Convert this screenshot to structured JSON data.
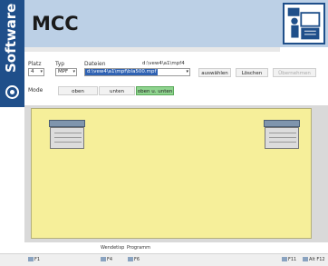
{
  "sidebar": {
    "label": "Software"
  },
  "header": {
    "title": "MCC"
  },
  "form": {
    "platz_label": "Platz",
    "platz_value": "4",
    "typ_label": "Typ",
    "typ_value": "MPF",
    "dateien_label": "Dateien",
    "path": "d:\\vew4\\a1\\mpf4",
    "file_value": "d:\\vew4\\a1\\mpf\\bla500.mpf",
    "btn_select": "auswählen",
    "btn_delete": "Löschen",
    "btn_disabled": "Übernehmen",
    "mode_label": "Mode",
    "mode_oben": "oben",
    "mode_unten": "unten",
    "mode_both": "oben u. unten"
  },
  "bottom": {
    "label_wendetisch": "Wendetisp",
    "label_programm": "Programm"
  },
  "footer": {
    "keys": [
      "F1",
      "F4",
      "F6",
      "F11",
      "Alt F12"
    ]
  },
  "colors": {
    "brand": "#1f4f8a",
    "header_bg": "#bcd0e6",
    "workspace": "#f6ef9a",
    "mode_active": "#8fd48f"
  }
}
